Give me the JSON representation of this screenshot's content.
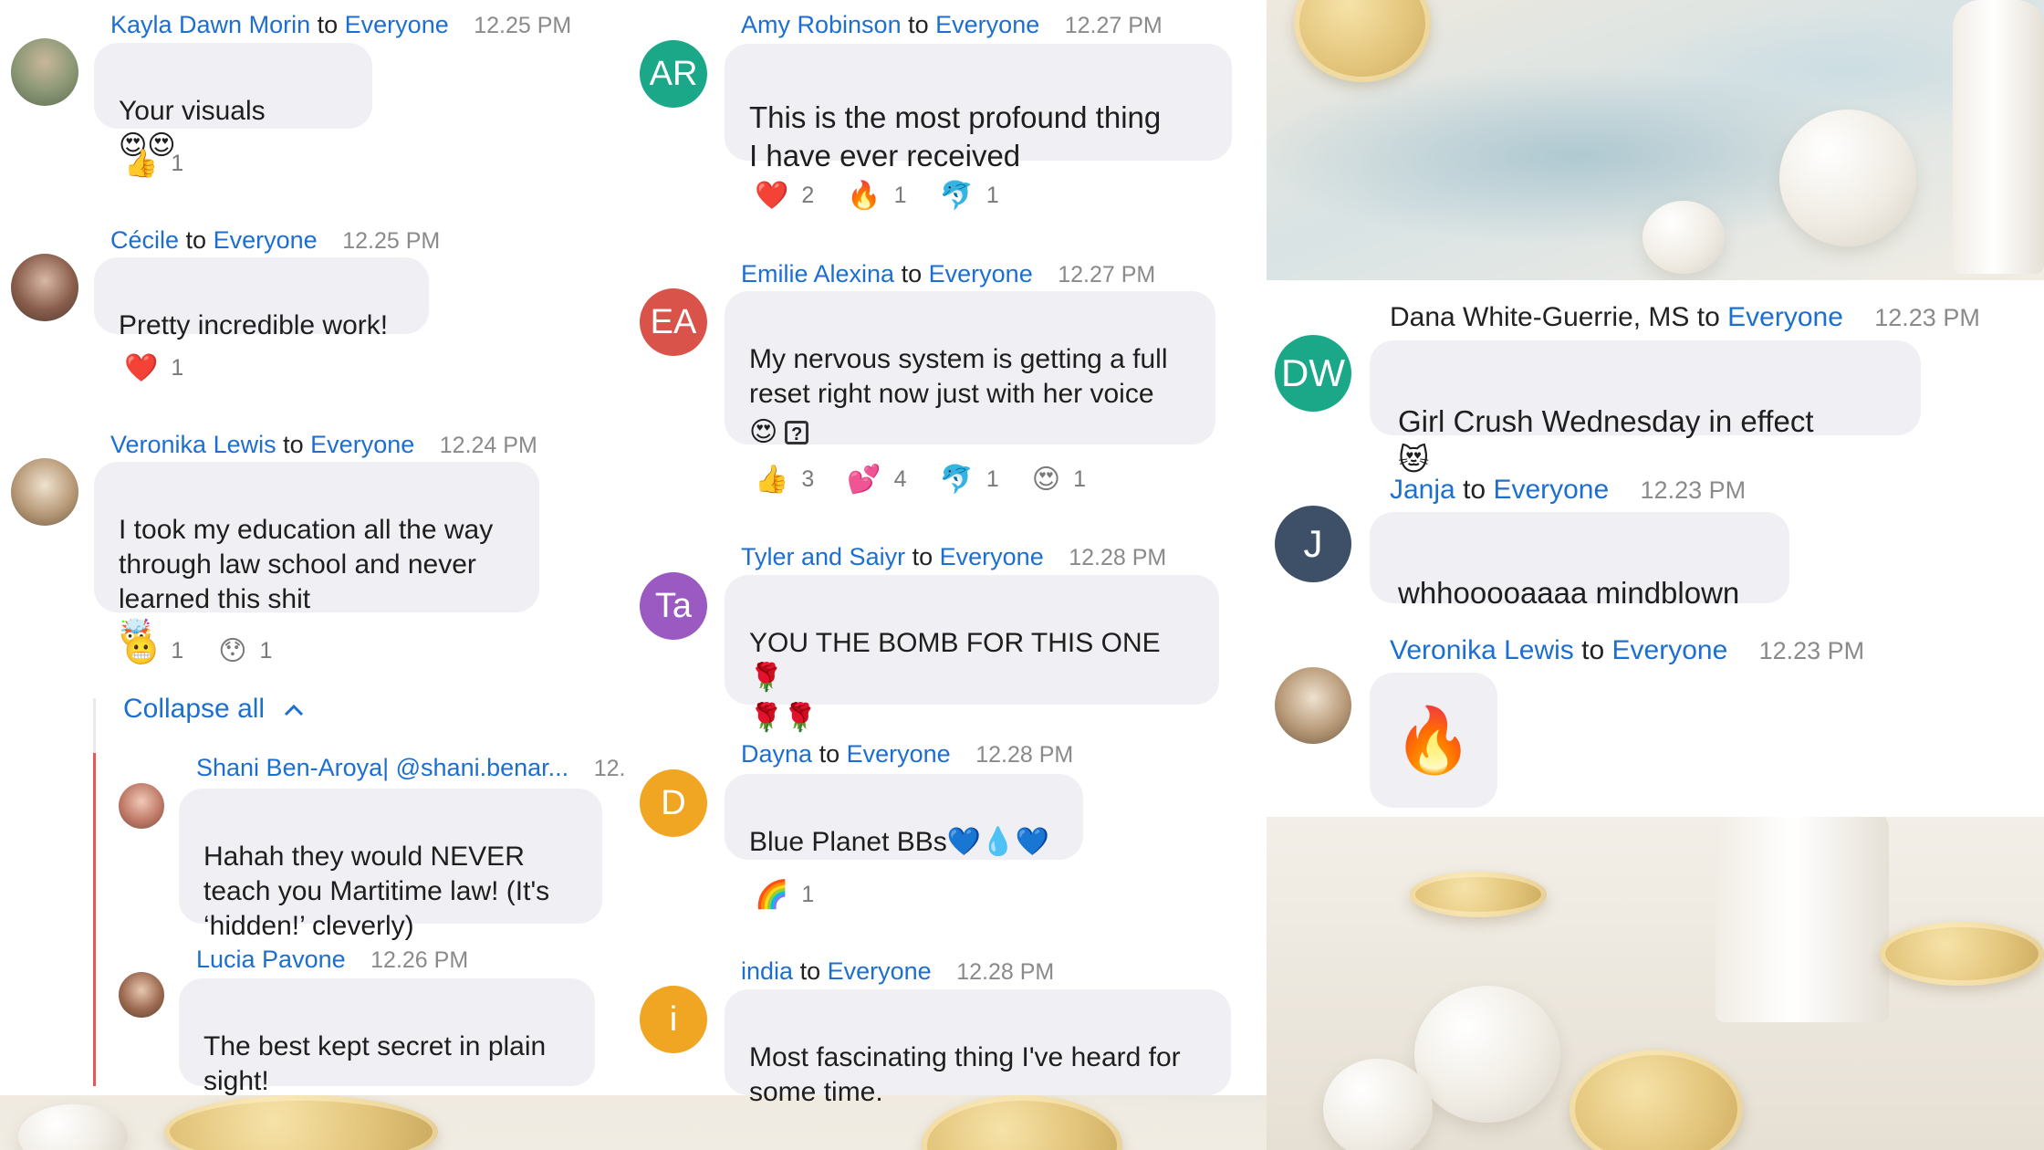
{
  "left": {
    "messages": [
      {
        "sender": "Kayla Dawn Morin",
        "to": "to",
        "recipient": "Everyone",
        "time": "12.25 PM",
        "text": "Your visuals",
        "emoji": "😍😍",
        "reactions": [
          {
            "emoji": "👍",
            "count": "1"
          }
        ]
      },
      {
        "sender": "Cécile",
        "to": "to",
        "recipient": "Everyone",
        "time": "12.25 PM",
        "text": "Pretty incredible work!",
        "reactions": [
          {
            "emoji": "❤️",
            "count": "1"
          }
        ]
      },
      {
        "sender": "Veronika Lewis",
        "to": "to",
        "recipient": "Everyone",
        "time": "12.24 PM",
        "text": "I took my education all the way\nthrough law school and never\nlearned this shit",
        "emoji": "🤯",
        "reactions": [
          {
            "emoji": "😬",
            "count": "1"
          },
          {
            "emoji": "😯",
            "count": "1"
          }
        ]
      }
    ],
    "collapse_label": "Collapse all",
    "replies": [
      {
        "sender": "Shani Ben-Aroya| @shani.benar...",
        "time": "12.",
        "text": "Hahah they would NEVER\nteach you Martitime law! (It's\n‘hidden!’ cleverly)"
      },
      {
        "sender": "Lucia Pavone",
        "time": "12.26 PM",
        "text": "The best kept secret in plain\nsight!"
      }
    ]
  },
  "middle": {
    "messages": [
      {
        "sender": "Amy Robinson",
        "to": "to",
        "recipient": "Everyone",
        "time": "12.27 PM",
        "initials": "AR",
        "avatar_color": "#1aa889",
        "text": "This is the most profound thing\nI have ever received",
        "reactions": [
          {
            "emoji": "❤️",
            "count": "2"
          },
          {
            "emoji": "🔥",
            "count": "1"
          },
          {
            "emoji": "🐬",
            "count": "1"
          }
        ]
      },
      {
        "sender": "Emilie Alexina",
        "to": "to",
        "recipient": "Everyone",
        "time": "12.27 PM",
        "initials": "EA",
        "avatar_color": "#d9534a",
        "text": "My nervous system is getting a full\nreset right now just with her voice",
        "reactions": [
          {
            "emoji": "👍",
            "count": "3"
          },
          {
            "emoji": "💕",
            "count": "4"
          },
          {
            "emoji": "🐬",
            "count": "1"
          },
          {
            "emoji": "😍",
            "count": "1"
          }
        ]
      },
      {
        "sender": "Tyler and Saiyr",
        "to": "to",
        "recipient": "Everyone",
        "time": "12.28 PM",
        "initials": "Ta",
        "avatar_color": "#9a5ac2",
        "text": "YOU THE BOMB FOR THIS ONE",
        "emoji": "🌹",
        "emoji2": "🌹🌹"
      },
      {
        "sender": "Dayna",
        "to": "to",
        "recipient": "Everyone",
        "time": "12.28 PM",
        "initials": "D",
        "avatar_color": "#f0a623",
        "text": "Blue Planet BBs",
        "emoji": "💙💧💙",
        "reactions": [
          {
            "emoji": "🌈",
            "count": "1"
          }
        ]
      },
      {
        "sender": "india",
        "to": "to",
        "recipient": "Everyone",
        "time": "12.28 PM",
        "initials": "i",
        "avatar_color": "#f0a623",
        "text": "Most fascinating thing I've heard for\nsome time."
      }
    ],
    "emilie_extra": "😍",
    "emilie_unknown": "?"
  },
  "right": {
    "messages": [
      {
        "sender": "Dana White-Guerrie, MS",
        "to": "to",
        "recipient": "Everyone",
        "time": "12.23 PM",
        "initials": "DW",
        "avatar_color": "#1aa889",
        "text": "Girl Crush Wednesday in effect",
        "emoji": "😻"
      },
      {
        "sender": "Janja",
        "to": "to",
        "recipient": "Everyone",
        "time": "12.23 PM",
        "initials": "J",
        "avatar_color": "#3d5068",
        "text": "whhooooaaaa mindblown"
      },
      {
        "sender": "Veronika Lewis",
        "to": "to",
        "recipient": "Everyone",
        "time": "12.23 PM",
        "emoji": "🔥"
      }
    ]
  },
  "colors": {
    "link": "#1c6fd0",
    "bubble": "#f0f0f4",
    "thread": "#e05a5a"
  }
}
